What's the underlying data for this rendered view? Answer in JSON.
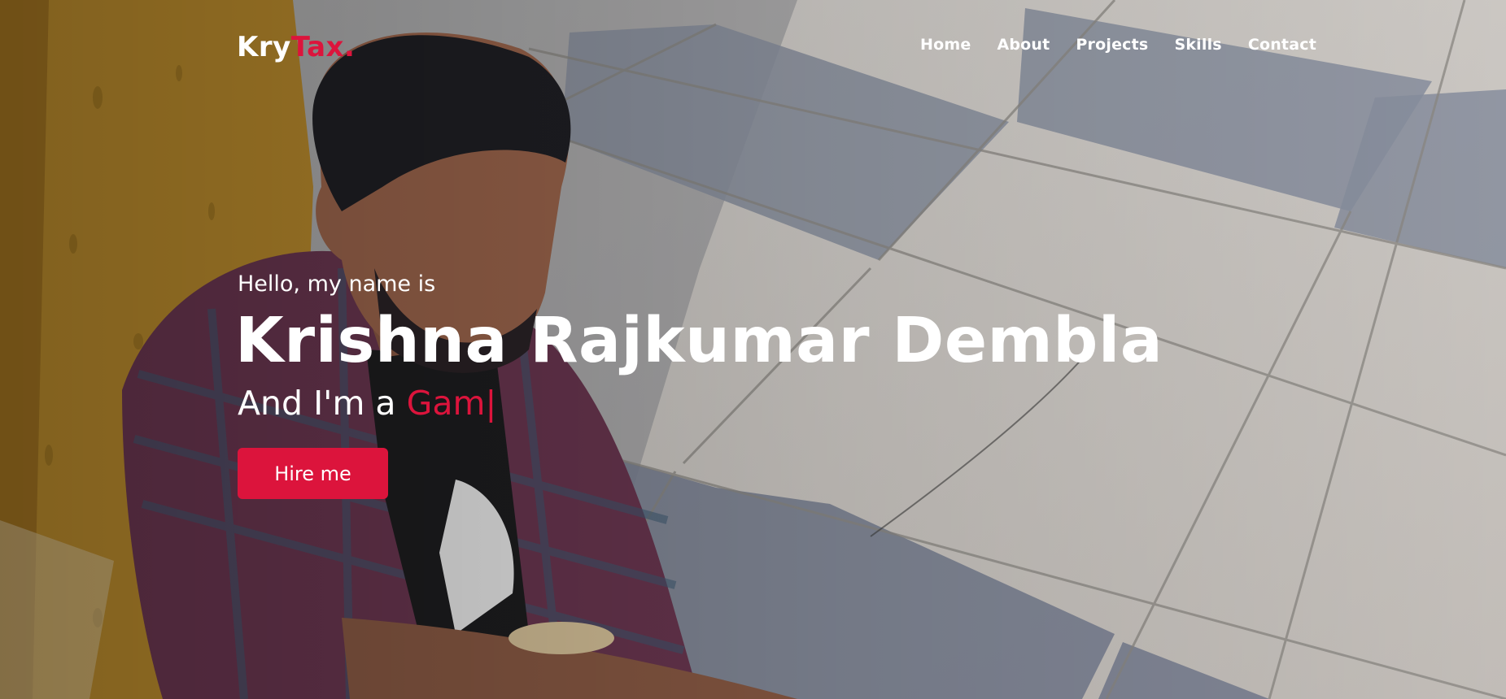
{
  "brand": {
    "logo_main": "Kry",
    "logo_accent": "Tax."
  },
  "nav": {
    "items": [
      {
        "label": "Home"
      },
      {
        "label": "About"
      },
      {
        "label": "Projects"
      },
      {
        "label": "Skills"
      },
      {
        "label": "Contact"
      }
    ]
  },
  "hero": {
    "greeting": "Hello, my name is",
    "name": "Krishna Rajkumar Dembla",
    "role_prefix": "And I'm a ",
    "role_typed": "Gam",
    "cursor": "|",
    "cta_label": "Hire me",
    "background_image": "photo-man-seated-on-tiled-floor"
  },
  "colors": {
    "accent": "#dc143c",
    "text": "#ffffff"
  }
}
